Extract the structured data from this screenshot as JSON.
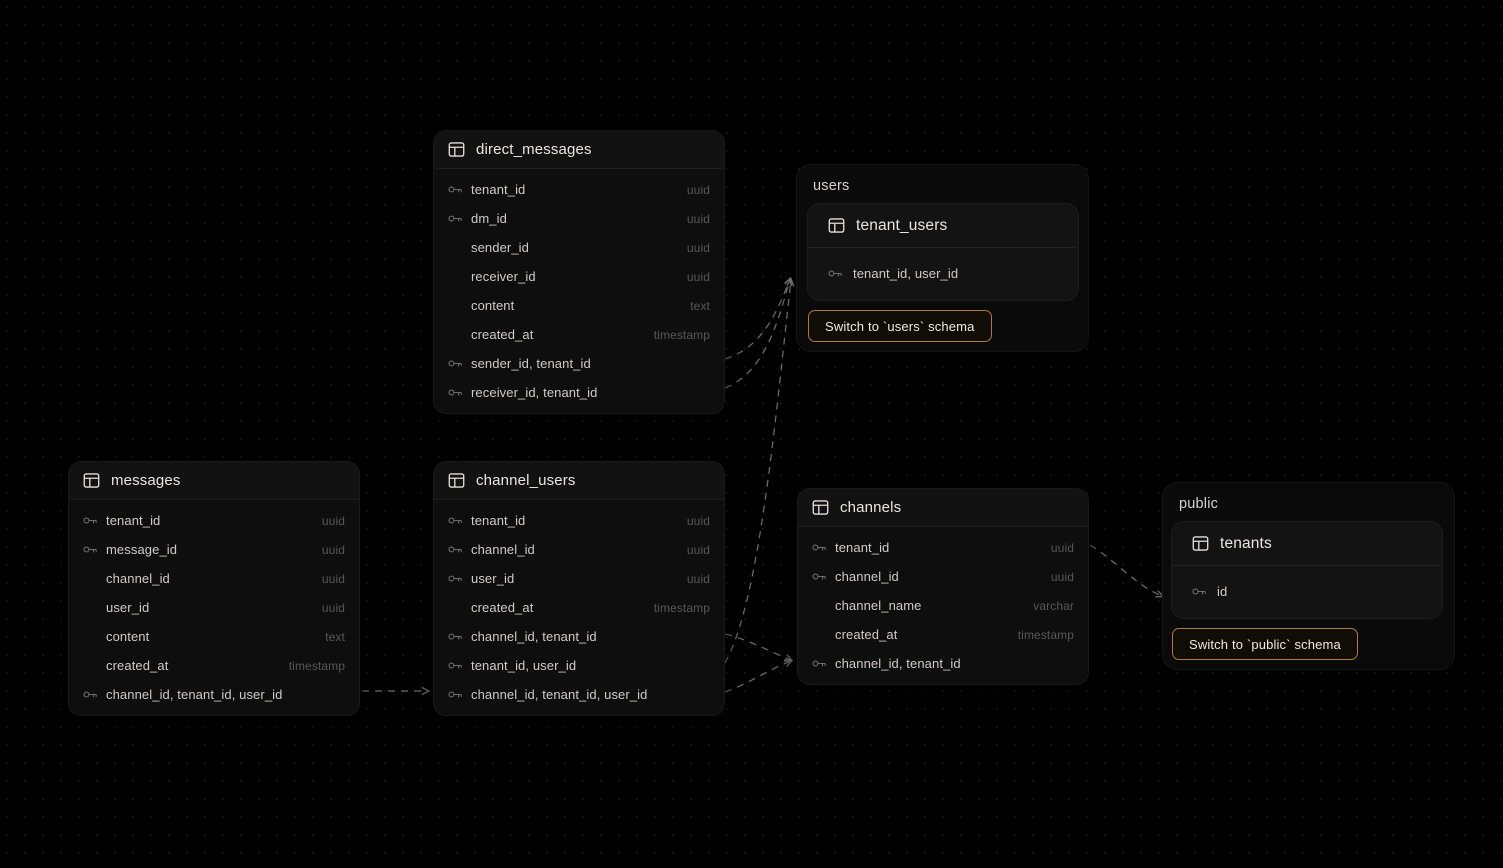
{
  "canvas": {
    "background_color": "#000000",
    "grid_dot_color": "#1c1c1c",
    "accent_color": "#b5793a",
    "edge_color": "#8c8c8c"
  },
  "schema_groups": [
    {
      "id": "users",
      "label": "users",
      "switch_button_label": "Switch to `users` schema"
    },
    {
      "id": "public",
      "label": "public",
      "switch_button_label": "Switch to `public` schema"
    }
  ],
  "tables": [
    {
      "id": "direct_messages",
      "name": "direct_messages",
      "icon": "table-icon",
      "columns": [
        {
          "name": "tenant_id",
          "type": "uuid",
          "key": true
        },
        {
          "name": "dm_id",
          "type": "uuid",
          "key": true
        },
        {
          "name": "sender_id",
          "type": "uuid",
          "key": false
        },
        {
          "name": "receiver_id",
          "type": "uuid",
          "key": false
        },
        {
          "name": "content",
          "type": "text",
          "key": false
        },
        {
          "name": "created_at",
          "type": "timestamp",
          "key": false
        },
        {
          "name": "sender_id, tenant_id",
          "type": "",
          "key": true
        },
        {
          "name": "receiver_id, tenant_id",
          "type": "",
          "key": true
        }
      ]
    },
    {
      "id": "tenant_users",
      "name": "tenant_users",
      "icon": "table-icon",
      "columns": [
        {
          "name": "tenant_id, user_id",
          "type": "",
          "key": true
        }
      ]
    },
    {
      "id": "messages",
      "name": "messages",
      "icon": "table-icon",
      "columns": [
        {
          "name": "tenant_id",
          "type": "uuid",
          "key": true
        },
        {
          "name": "message_id",
          "type": "uuid",
          "key": true
        },
        {
          "name": "channel_id",
          "type": "uuid",
          "key": false
        },
        {
          "name": "user_id",
          "type": "uuid",
          "key": false
        },
        {
          "name": "content",
          "type": "text",
          "key": false
        },
        {
          "name": "created_at",
          "type": "timestamp",
          "key": false
        },
        {
          "name": "channel_id, tenant_id, user_id",
          "type": "",
          "key": true
        }
      ]
    },
    {
      "id": "channel_users",
      "name": "channel_users",
      "icon": "table-icon",
      "columns": [
        {
          "name": "tenant_id",
          "type": "uuid",
          "key": true
        },
        {
          "name": "channel_id",
          "type": "uuid",
          "key": true
        },
        {
          "name": "user_id",
          "type": "uuid",
          "key": true
        },
        {
          "name": "created_at",
          "type": "timestamp",
          "key": false
        },
        {
          "name": "channel_id, tenant_id",
          "type": "",
          "key": true
        },
        {
          "name": "tenant_id, user_id",
          "type": "",
          "key": true
        },
        {
          "name": "channel_id, tenant_id, user_id",
          "type": "",
          "key": true
        }
      ]
    },
    {
      "id": "channels",
      "name": "channels",
      "icon": "table-icon",
      "columns": [
        {
          "name": "tenant_id",
          "type": "uuid",
          "key": true
        },
        {
          "name": "channel_id",
          "type": "uuid",
          "key": true
        },
        {
          "name": "channel_name",
          "type": "varchar",
          "key": false
        },
        {
          "name": "created_at",
          "type": "timestamp",
          "key": false
        },
        {
          "name": "channel_id, tenant_id",
          "type": "",
          "key": true
        }
      ]
    },
    {
      "id": "tenants",
      "name": "tenants",
      "icon": "table-icon",
      "columns": [
        {
          "name": "id",
          "type": "",
          "key": true
        }
      ]
    }
  ]
}
